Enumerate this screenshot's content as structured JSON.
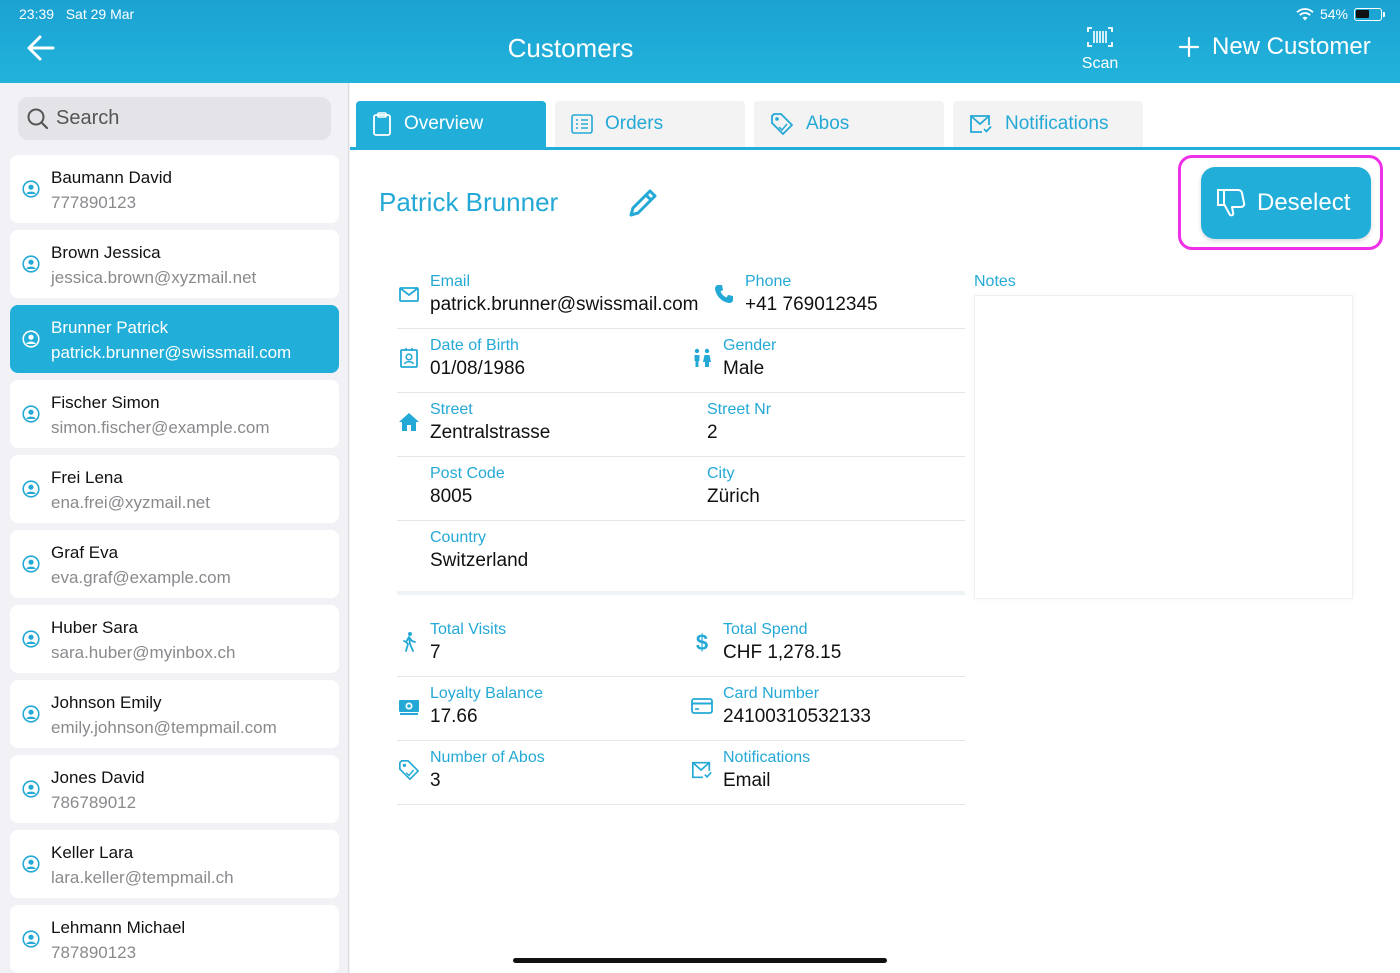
{
  "status": {
    "time": "23:39",
    "date": "Sat 29 Mar",
    "battery": "54%"
  },
  "header": {
    "title": "Customers",
    "scan_label": "Scan",
    "new_customer_label": "New Customer"
  },
  "search": {
    "placeholder": "Search"
  },
  "customers": [
    {
      "name": "Baumann David",
      "sub": "777890123",
      "selected": false
    },
    {
      "name": "Brown Jessica",
      "sub": "jessica.brown@xyzmail.net",
      "selected": false
    },
    {
      "name": "Brunner Patrick",
      "sub": "patrick.brunner@swissmail.com",
      "selected": true
    },
    {
      "name": "Fischer Simon",
      "sub": "simon.fischer@example.com",
      "selected": false
    },
    {
      "name": "Frei Lena",
      "sub": "ena.frei@xyzmail.net",
      "selected": false
    },
    {
      "name": "Graf Eva",
      "sub": "eva.graf@example.com",
      "selected": false
    },
    {
      "name": "Huber Sara",
      "sub": "sara.huber@myinbox.ch",
      "selected": false
    },
    {
      "name": "Johnson Emily",
      "sub": "emily.johnson@tempmail.com",
      "selected": false
    },
    {
      "name": "Jones David",
      "sub": "786789012",
      "selected": false
    },
    {
      "name": "Keller Lara",
      "sub": "lara.keller@tempmail.ch",
      "selected": false
    },
    {
      "name": "Lehmann Michael",
      "sub": "787890123",
      "selected": false
    }
  ],
  "tabs": [
    {
      "label": "Overview",
      "icon": "clipboard-icon",
      "active": true
    },
    {
      "label": "Orders",
      "icon": "list-icon",
      "active": false
    },
    {
      "label": "Abos",
      "icon": "tag-icon",
      "active": false
    },
    {
      "label": "Notifications",
      "icon": "mail-check-icon",
      "active": false
    }
  ],
  "detail": {
    "name": "Patrick Brunner",
    "deselect_label": "Deselect",
    "email_label": "Email",
    "email": "patrick.brunner@swissmail.com",
    "phone_label": "Phone",
    "phone": "+41 769012345",
    "dob_label": "Date of Birth",
    "dob": "01/08/1986",
    "gender_label": "Gender",
    "gender": "Male",
    "street_label": "Street",
    "street": "Zentralstrasse",
    "street_nr_label": "Street Nr",
    "street_nr": "2",
    "post_code_label": "Post Code",
    "post_code": "8005",
    "city_label": "City",
    "city": "Zürich",
    "country_label": "Country",
    "country": "Switzerland",
    "total_visits_label": "Total Visits",
    "total_visits": "7",
    "total_spend_label": "Total Spend",
    "total_spend": "CHF 1,278.15",
    "loyalty_label": "Loyalty Balance",
    "loyalty": "17.66",
    "card_label": "Card Number",
    "card": "24100310532133",
    "abos_label": "Number of Abos",
    "abos": "3",
    "notifications_label": "Notifications",
    "notifications": "Email",
    "notes_label": "Notes"
  },
  "colors": {
    "accent": "#21aed8",
    "highlight": "#f030e8"
  }
}
